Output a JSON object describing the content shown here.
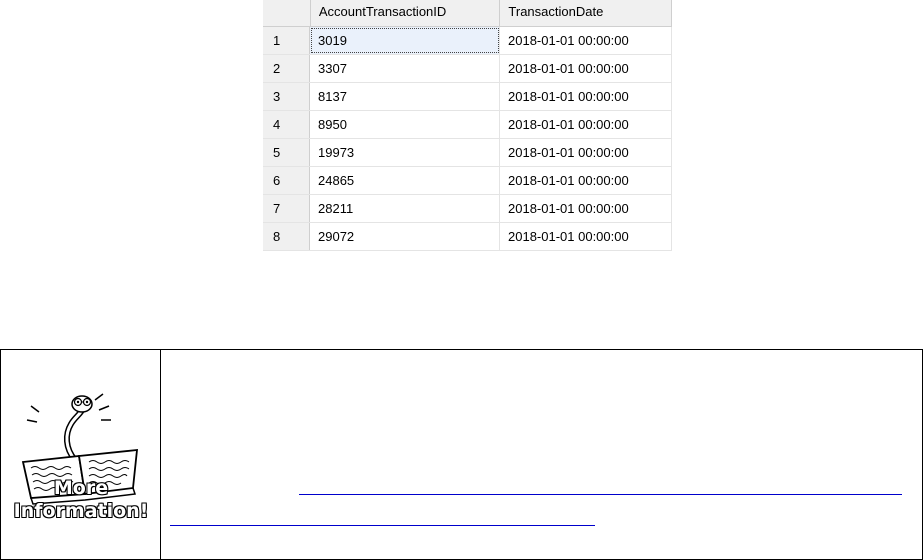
{
  "results_grid": {
    "columns": [
      "AccountTransactionID",
      "TransactionDate"
    ],
    "rows": [
      {
        "num": "1",
        "id": "3019",
        "date": "2018-01-01 00:00:00"
      },
      {
        "num": "2",
        "id": "3307",
        "date": "2018-01-01 00:00:00"
      },
      {
        "num": "3",
        "id": "8137",
        "date": "2018-01-01 00:00:00"
      },
      {
        "num": "4",
        "id": "8950",
        "date": "2018-01-01 00:00:00"
      },
      {
        "num": "5",
        "id": "19973",
        "date": "2018-01-01 00:00:00"
      },
      {
        "num": "6",
        "id": "24865",
        "date": "2018-01-01 00:00:00"
      },
      {
        "num": "7",
        "id": "28211",
        "date": "2018-01-01 00:00:00"
      },
      {
        "num": "8",
        "id": "29072",
        "date": "2018-01-01 00:00:00"
      }
    ],
    "selected_cell": "3019"
  },
  "info_box": {
    "icon": "book-worm-icon",
    "label_line1": "More",
    "label_line2": "Information!"
  }
}
